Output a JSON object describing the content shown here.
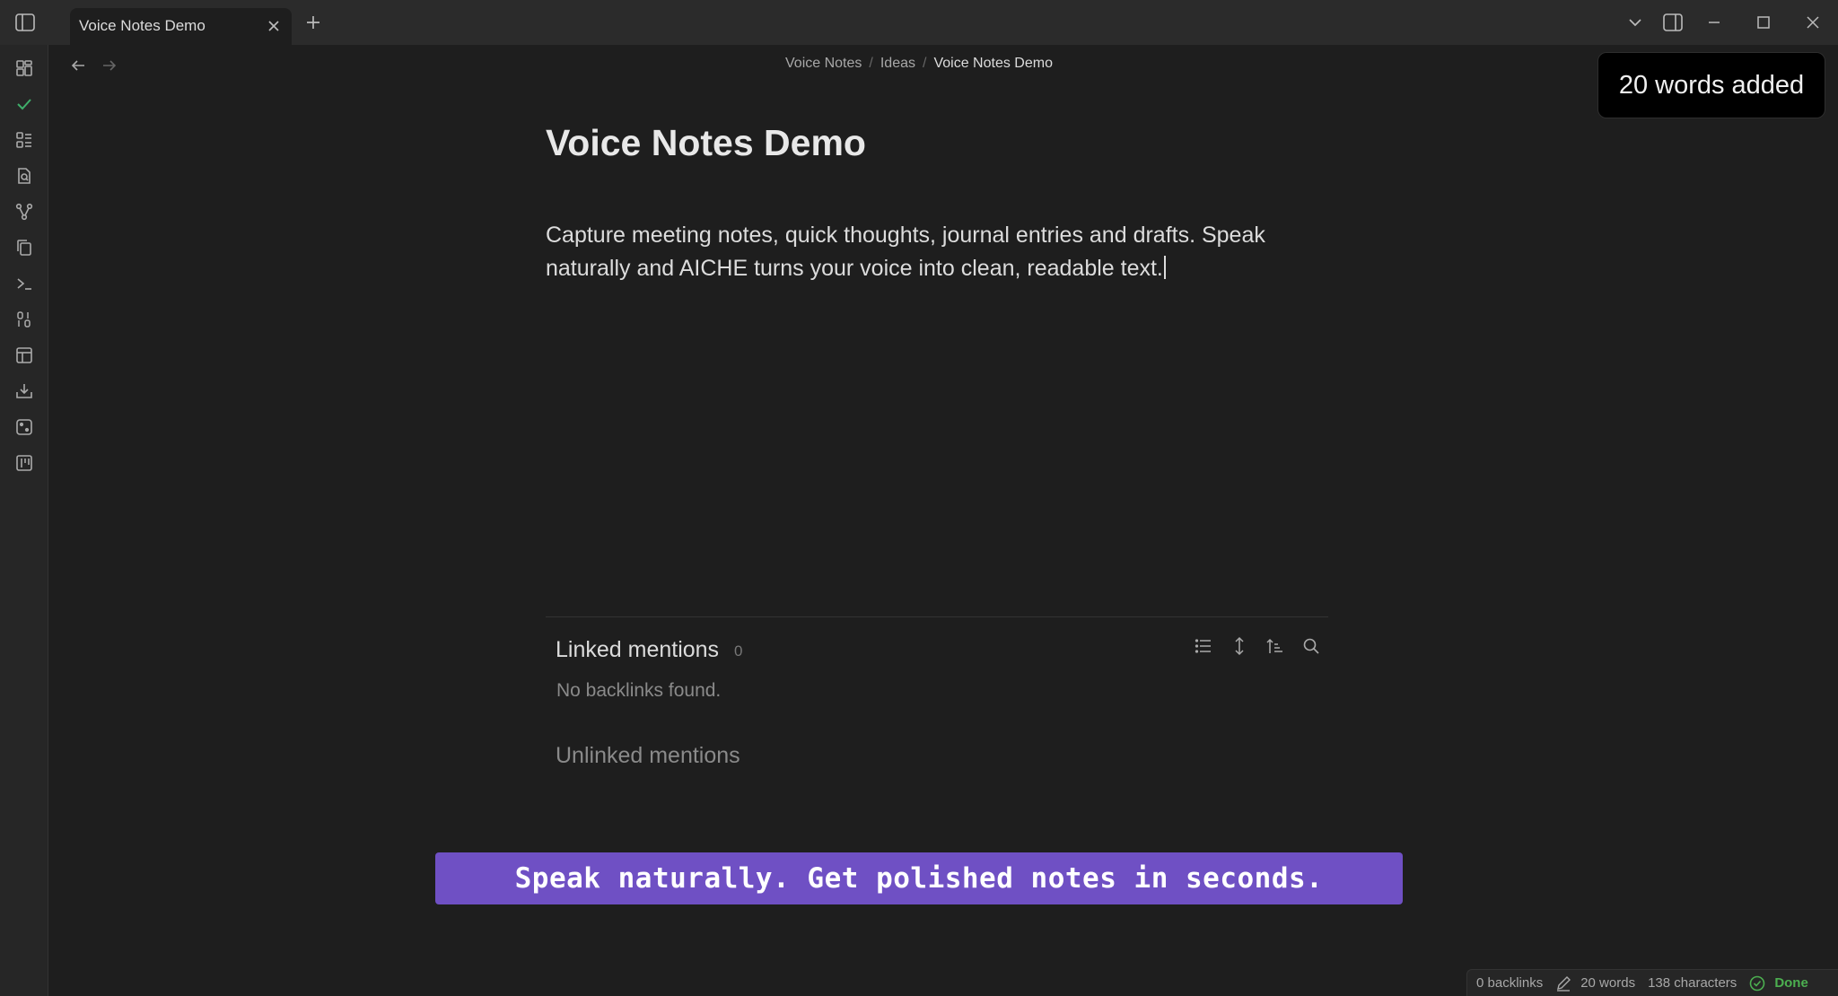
{
  "tab": {
    "title": "Voice Notes Demo"
  },
  "breadcrumb": [
    "Voice Notes",
    "Ideas",
    "Voice Notes Demo"
  ],
  "toast": "20 words added",
  "note": {
    "title": "Voice Notes Demo",
    "body": "Capture meeting notes, quick thoughts, journal entries and drafts. Speak naturally and AICHE turns your voice into clean, readable text."
  },
  "backlinks": {
    "linked_label": "Linked mentions",
    "linked_count": "0",
    "empty_text": "No backlinks found.",
    "unlinked_label": "Unlinked mentions"
  },
  "banner": "Speak naturally. Get polished notes in seconds.",
  "status": {
    "backlinks": "0 backlinks",
    "words": "20 words",
    "characters": "138 characters",
    "sync": "Done"
  },
  "ribbon_icons": [
    "dashboard-icon",
    "check-icon",
    "list-icon",
    "file-search-icon",
    "graph-icon",
    "copy-icon",
    "terminal-icon",
    "binary-icon",
    "table-icon",
    "import-icon",
    "dice-icon",
    "kanban-icon"
  ],
  "colors": {
    "accent": "#6f50c4",
    "success": "#4caf50",
    "check": "#3fae6a"
  }
}
